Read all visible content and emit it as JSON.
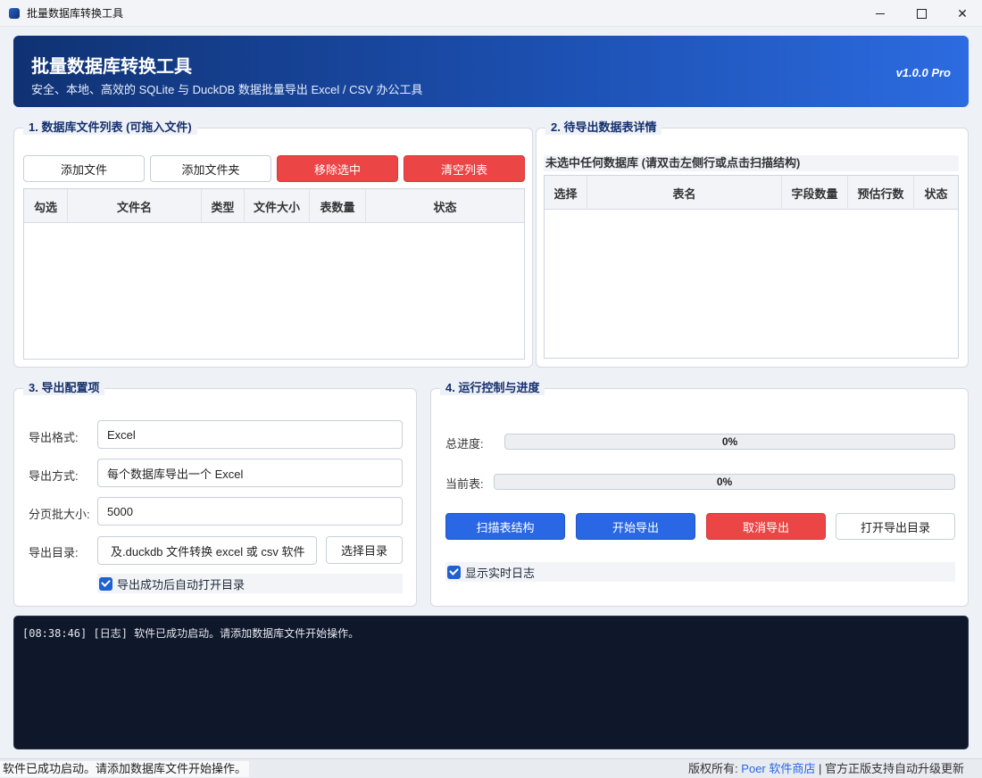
{
  "window": {
    "title": "批量数据库转换工具"
  },
  "hero": {
    "title": "批量数据库转换工具",
    "subtitle": "安全、本地、高效的 SQLite 与 DuckDB 数据批量导出 Excel / CSV 办公工具",
    "version": "v1.0.0 Pro"
  },
  "files_panel": {
    "title": "1. 数据库文件列表 (可拖入文件)",
    "buttons": {
      "add_file": "添加文件",
      "add_folder": "添加文件夹",
      "remove_selected": "移除选中",
      "clear_list": "清空列表"
    },
    "columns": [
      "勾选",
      "文件名",
      "类型",
      "文件大小",
      "表数量",
      "状态"
    ],
    "rows": []
  },
  "tables_panel": {
    "title": "2. 待导出数据表详情",
    "notice": "未选中任何数据库 (请双击左侧行或点击扫描结构)",
    "columns": [
      "选择",
      "表名",
      "字段数量",
      "预估行数",
      "状态"
    ],
    "rows": []
  },
  "config_panel": {
    "title": "3. 导出配置项",
    "format_label": "导出格式:",
    "format_value": "Excel",
    "mode_label": "导出方式:",
    "mode_value": "每个数据库导出一个 Excel",
    "batch_label": "分页批大小:",
    "batch_value": "5000",
    "dir_label": "导出目录:",
    "dir_value": "及.duckdb 文件转换 excel 或 csv 软件",
    "choose_dir": "选择目录",
    "auto_open_label": "导出成功后自动打开目录",
    "auto_open_checked": true
  },
  "control_panel": {
    "title": "4. 运行控制与进度",
    "total_label": "总进度:",
    "total_progress": 0,
    "total_text": "0%",
    "current_label": "当前表:",
    "current_progress": 0,
    "current_text": "0%",
    "buttons": {
      "scan": "扫描表结构",
      "start": "开始导出",
      "cancel": "取消导出",
      "open_dir": "打开导出目录"
    },
    "show_log_label": "显示实时日志",
    "show_log_checked": true
  },
  "log": {
    "lines": [
      "[08:38:46] [日志] 软件已成功启动。请添加数据库文件开始操作。"
    ]
  },
  "statusbar": {
    "message": "软件已成功启动。请添加数据库文件开始操作。",
    "copyright_prefix": "版权所有:",
    "store": "Poer 软件商店",
    "suffix": "| 官方正版支持自动升级更新"
  }
}
